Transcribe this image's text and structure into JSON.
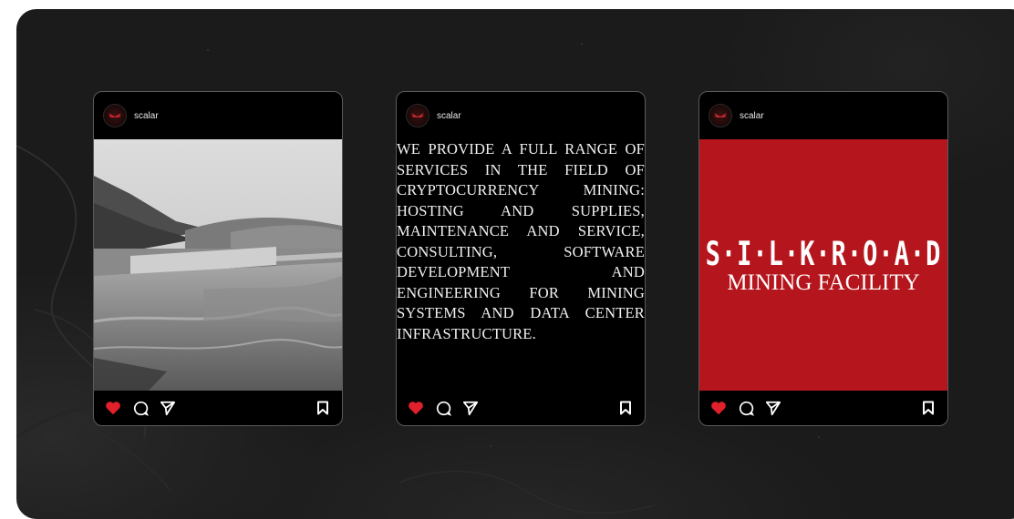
{
  "background": {
    "color": "#1b1b1b"
  },
  "posts": [
    {
      "username": "scalar",
      "type": "photo",
      "image_description_icon": "landscape-photo"
    },
    {
      "username": "scalar",
      "type": "text",
      "text": "We provide a full range of services in the field of cryptocurrency mining: hosting and supplies, maintenance and service, consulting, software development and engineering for mining systems and data center infrastructure."
    },
    {
      "username": "scalar",
      "type": "brand",
      "title": "S·I·L·K·R·O·A·D",
      "subtitle": "MINING FACILITY",
      "accent_color": "#b5161d"
    }
  ],
  "actions": {
    "like_icon": "heart-icon",
    "comment_icon": "comment-icon",
    "share_icon": "send-icon",
    "save_icon": "bookmark-icon",
    "like_color": "#e0202a"
  }
}
